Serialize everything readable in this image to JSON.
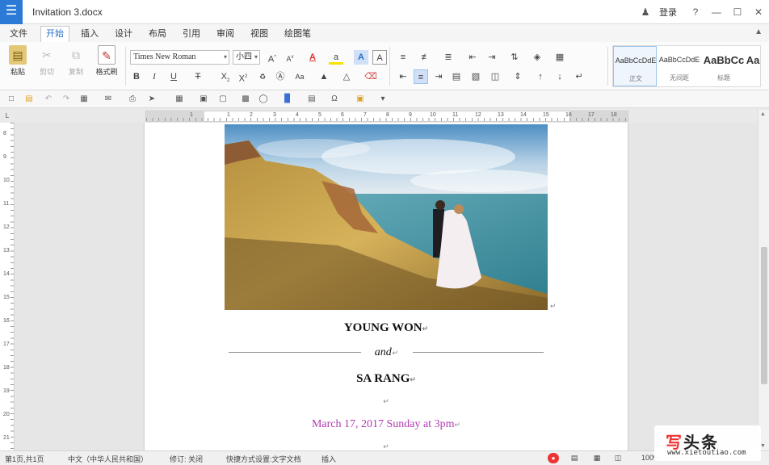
{
  "window": {
    "title": "Invitation 3.docx",
    "login_label": "登录",
    "help_icon": "?"
  },
  "menu": {
    "tabs": [
      "文件",
      "开始",
      "插入",
      "设计",
      "布局",
      "引用",
      "审阅",
      "视图",
      "绘图笔"
    ],
    "active_index": 1
  },
  "ribbon": {
    "paste_label": "粘贴",
    "cut_label": "剪切",
    "copy_label": "复制",
    "format_painter_label": "格式刷",
    "font_name": "Times New Roman",
    "font_size": "小四",
    "styles": [
      {
        "preview": "AaBbCcDdE",
        "name": "正文"
      },
      {
        "preview": "AaBbCcDdE",
        "name": "无间距"
      },
      {
        "preview": "AaBbCc",
        "name": "标题"
      },
      {
        "preview": "Aa",
        "name": ""
      }
    ],
    "accent_color": "#2b6fc6",
    "font_color": "#e03030",
    "highlight_color": "#f5e300"
  },
  "ruler": {
    "corner": "L",
    "h_marks": [
      "1",
      "1",
      "2",
      "3",
      "4",
      "5",
      "6",
      "7",
      "8",
      "9",
      "10",
      "11",
      "12",
      "13",
      "14",
      "15",
      "16",
      "17",
      "18"
    ],
    "v_marks": [
      "8",
      "9",
      "10",
      "11",
      "12",
      "13",
      "14",
      "15",
      "16",
      "17",
      "18",
      "19",
      "20",
      "21"
    ]
  },
  "document": {
    "groom": "YOUNG WON",
    "and_text": "and",
    "bride": "SA RANG",
    "date_line": "March 17, 2017 Sunday at 3pm",
    "paragraph_mark": "↵",
    "date_color": "#b23bb0"
  },
  "status": {
    "page": "第1页,共1页",
    "language": "中文（中华人民共和国）",
    "track_changes": "修订: 关闭",
    "ime_mode": "快捷方式设置:文字文档",
    "insert_mode": "插入",
    "zoom": "100%"
  },
  "watermark": {
    "logo_a": "写",
    "logo_b": "头条",
    "url": "www.xietoutiao.com"
  }
}
